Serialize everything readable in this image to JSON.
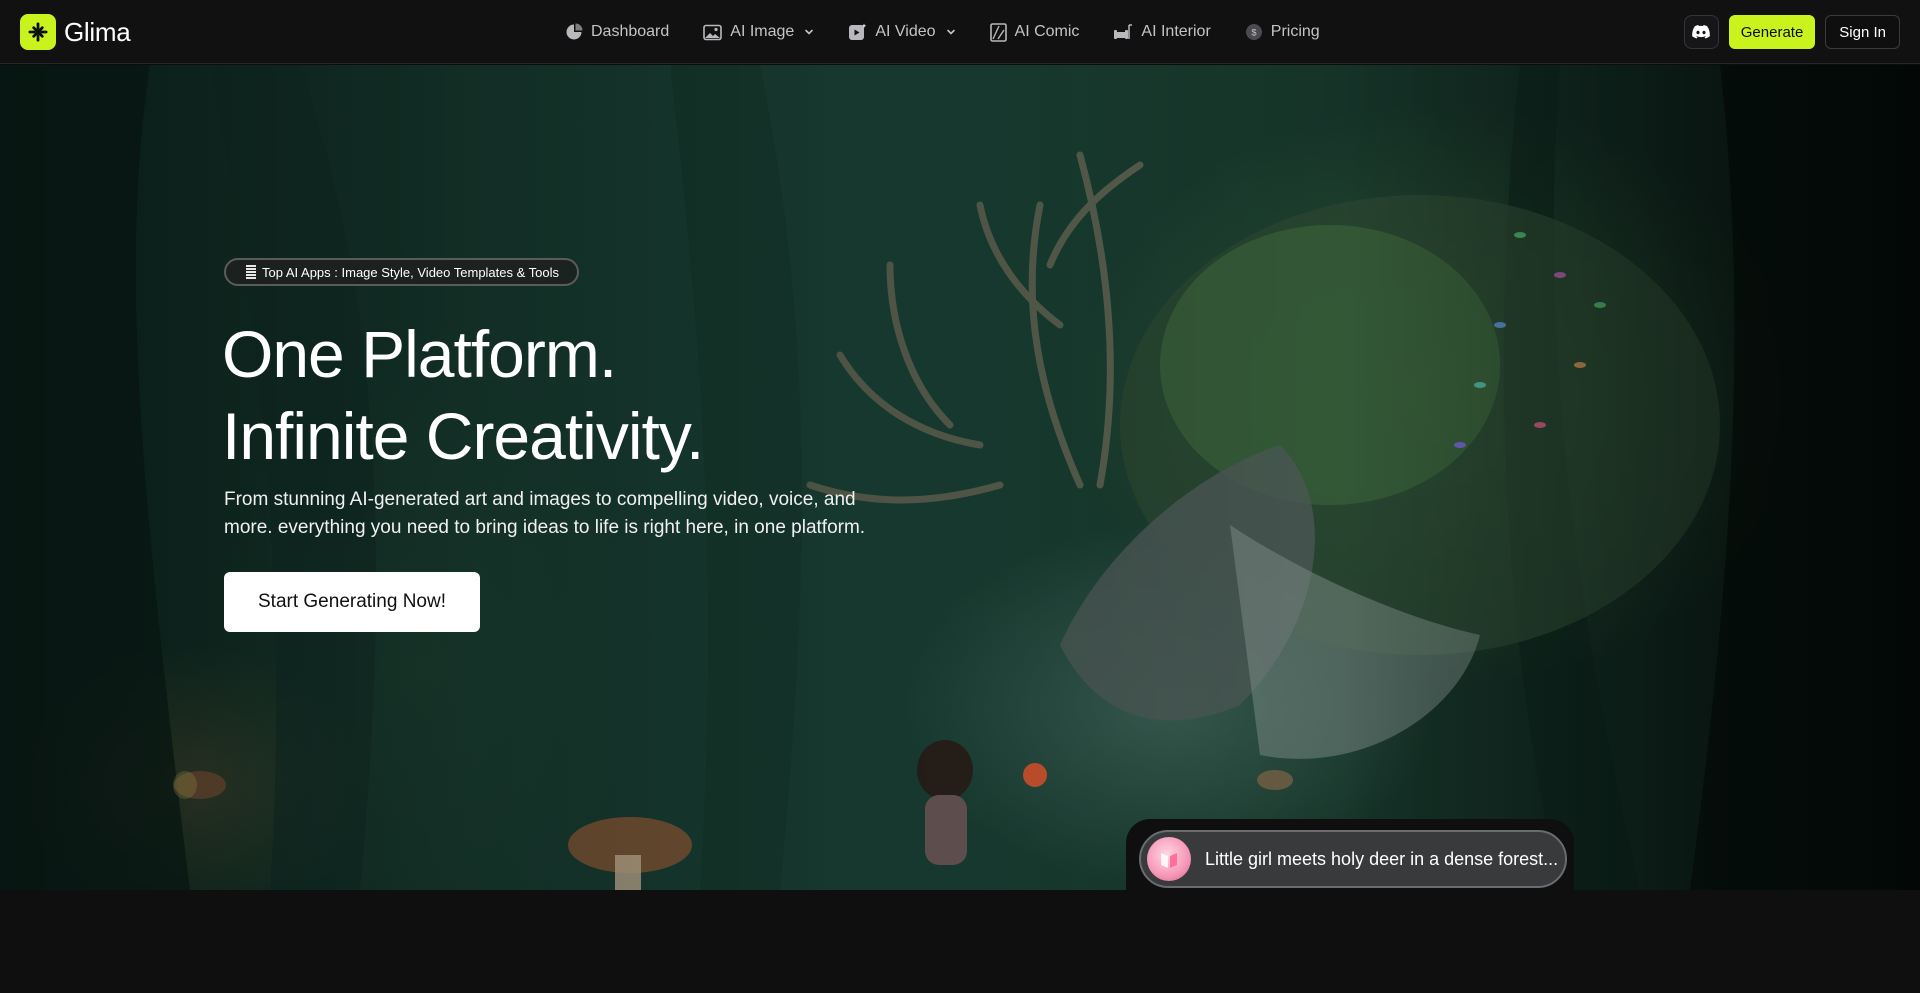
{
  "brand": {
    "name": "Glima",
    "accent": "#c9f31d"
  },
  "nav": {
    "items": [
      {
        "label": "Dashboard",
        "icon": "dashboard-icon"
      },
      {
        "label": "AI Image",
        "icon": "image-icon",
        "dropdown": true
      },
      {
        "label": "AI Video",
        "icon": "video-icon",
        "dropdown": true
      },
      {
        "label": "AI Comic",
        "icon": "comic-icon"
      },
      {
        "label": "AI Interior",
        "icon": "interior-icon"
      },
      {
        "label": "Pricing",
        "icon": "coin-icon"
      }
    ]
  },
  "header": {
    "discord_icon": "discord-icon",
    "generate_label": "Generate",
    "signin_label": "Sign In"
  },
  "hero": {
    "badge": "Top AI Apps : Image Style, Video Templates & Tools",
    "headline_line1": "One Platform.",
    "headline_line2": "Infinite Creativity.",
    "subtitle": "From stunning AI-generated art and images to compelling video, voice, and more. everything you need to bring ideas to life is right here, in one platform.",
    "cta_label": "Start Generating Now!",
    "prompt_text": "Little girl meets holy deer in a dense forest..."
  }
}
